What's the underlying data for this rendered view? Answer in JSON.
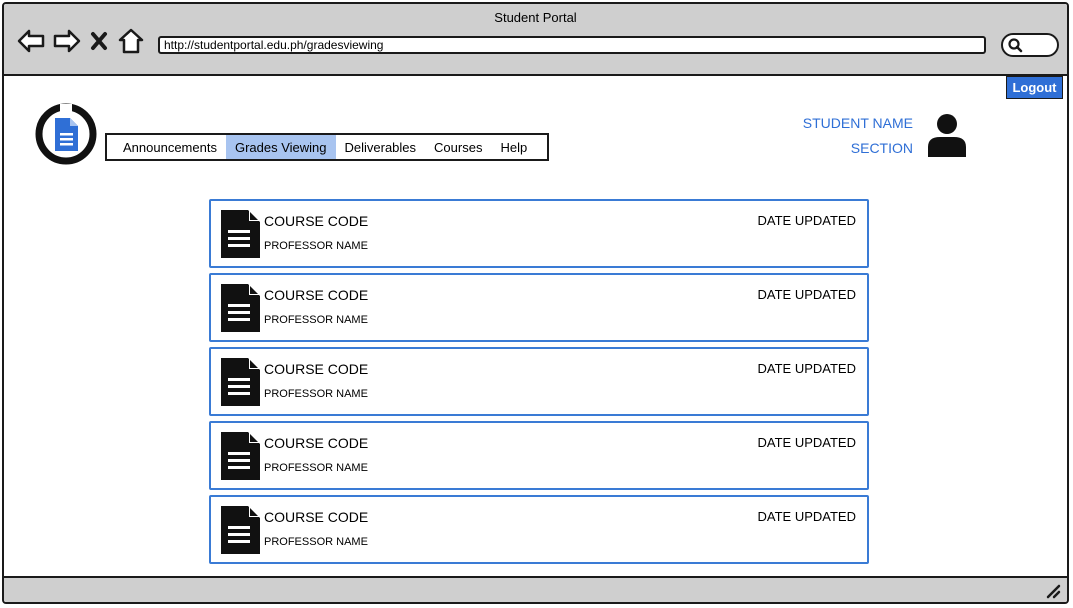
{
  "window": {
    "title": "Student Portal"
  },
  "browser": {
    "url": "http://studentportal.edu.ph/gradesviewing",
    "icons": [
      "back-arrow-icon",
      "forward-arrow-icon",
      "close-icon",
      "home-icon",
      "search-icon"
    ]
  },
  "header": {
    "logout_label": "Logout",
    "student_name": "STUDENT NAME",
    "section": "SECTION"
  },
  "nav": {
    "tabs": [
      {
        "label": "Announcements",
        "active": false
      },
      {
        "label": "Grades Viewing",
        "active": true
      },
      {
        "label": "Deliverables",
        "active": false
      },
      {
        "label": "Courses",
        "active": false
      },
      {
        "label": "Help",
        "active": false
      }
    ]
  },
  "courses": [
    {
      "code": "COURSE CODE",
      "professor": "PROFESSOR NAME",
      "date": "DATE UPDATED"
    },
    {
      "code": "COURSE CODE",
      "professor": "PROFESSOR NAME",
      "date": "DATE UPDATED"
    },
    {
      "code": "COURSE CODE",
      "professor": "PROFESSOR NAME",
      "date": "DATE UPDATED"
    },
    {
      "code": "COURSE CODE",
      "professor": "PROFESSOR NAME",
      "date": "DATE UPDATED"
    },
    {
      "code": "COURSE CODE",
      "professor": "PROFESSOR NAME",
      "date": "DATE UPDATED"
    }
  ],
  "colors": {
    "accent": "#2f6fd6",
    "active_tab": "#a8c4f0",
    "chrome": "#cfcfcf"
  }
}
